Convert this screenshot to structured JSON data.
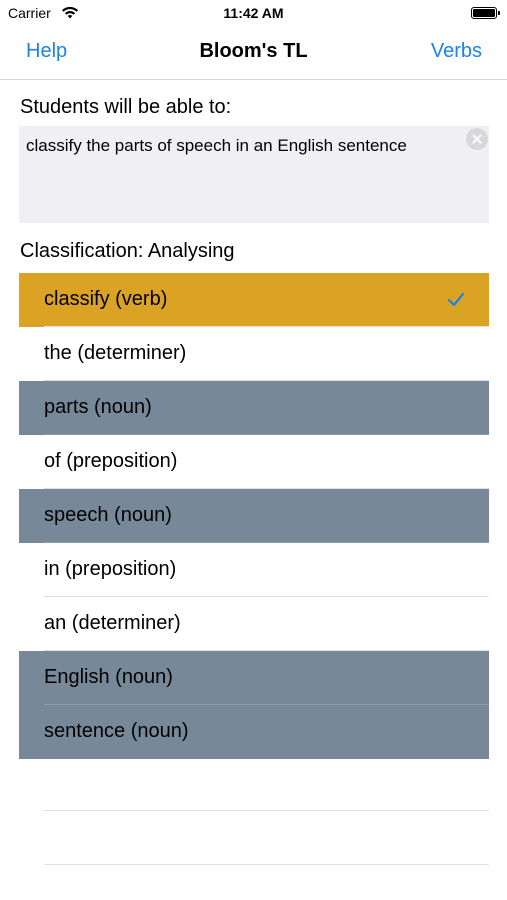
{
  "status_bar": {
    "carrier": "Carrier",
    "time": "11:42 AM"
  },
  "nav": {
    "left": "Help",
    "title": "Bloom's TL",
    "right": "Verbs",
    "accent_color": "#1a83ee"
  },
  "objective": {
    "heading": "Students will be able to:",
    "text": "classify the parts of speech in an English sentence"
  },
  "classification": {
    "label": "Classification: Analysing"
  },
  "words": [
    {
      "label": "classify (verb)",
      "style": "selected",
      "checked": true
    },
    {
      "label": "the (determiner)",
      "style": "plain",
      "checked": false
    },
    {
      "label": "parts (noun)",
      "style": "noun",
      "checked": false
    },
    {
      "label": "of (preposition)",
      "style": "plain",
      "checked": false
    },
    {
      "label": "speech (noun)",
      "style": "noun",
      "checked": false
    },
    {
      "label": "in (preposition)",
      "style": "plain",
      "checked": false
    },
    {
      "label": "an (determiner)",
      "style": "plain",
      "checked": false
    },
    {
      "label": "English (noun)",
      "style": "noun",
      "checked": false
    },
    {
      "label": "sentence (noun)",
      "style": "noun",
      "checked": false
    }
  ],
  "colors": {
    "selected_row": "#dba323",
    "noun_row": "#778899",
    "checkmark": "#1a83ee"
  }
}
